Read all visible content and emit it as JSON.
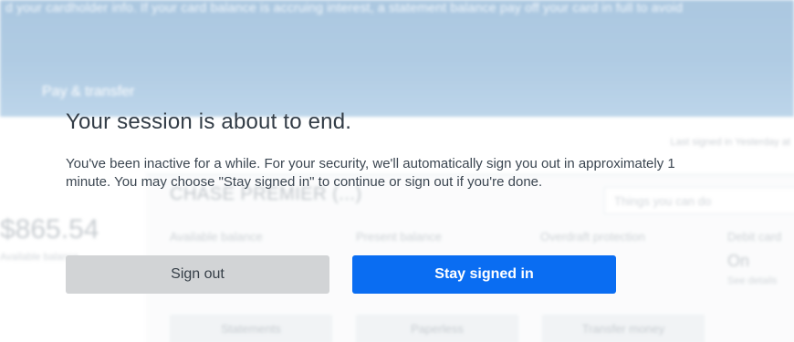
{
  "background": {
    "banner_text": "d your cardholder info. If your card balance is accruing interest, a statement balance pay off your card in full to avoid",
    "nav_item": "Pay & transfer",
    "last_signed": "Last signed in Yesterday at",
    "left_balance": "$865.54",
    "left_sub": "Available balance",
    "account_name": "CHASE PREMIER (...)",
    "search_placeholder": "Things you can do",
    "col_available": "Available balance",
    "col_present": "Present balance",
    "col_overdraft": "Overdraft protection",
    "col_debit": "Debit card",
    "col_debit_value": "On",
    "col_debit_sub": "See details",
    "btn_statements": "Statements",
    "btn_paperless": "Paperless",
    "btn_transfer": "Transfer money"
  },
  "modal": {
    "title": "Your session is about to end.",
    "body": "You've been inactive for a while. For your security, we'll automatically sign you out in approximately 1 minute. You may choose \"Stay signed in\" to continue or sign out if you're done.",
    "sign_out_label": "Sign out",
    "stay_signed_in_label": "Stay signed in"
  },
  "colors": {
    "primary": "#0a6df2",
    "secondary_button": "#d2d4d6",
    "header_blue": "#0b5ea6"
  }
}
